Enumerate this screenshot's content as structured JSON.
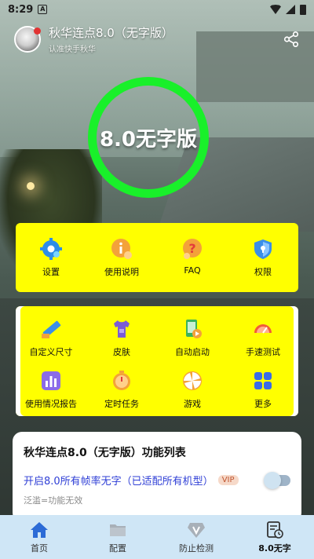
{
  "status_bar": {
    "time": "8:29",
    "a_badge": "A"
  },
  "header": {
    "title": "秋华连点8.0（无字版）",
    "subtitle": "认准快手秋华"
  },
  "ring": {
    "text": "8.0无字版",
    "color": "#19f02a"
  },
  "top_menu": [
    {
      "label": "设置",
      "icon": "gear-icon"
    },
    {
      "label": "使用说明",
      "icon": "info-icon"
    },
    {
      "label": "FAQ",
      "icon": "question-icon"
    },
    {
      "label": "权限",
      "icon": "shield-icon"
    }
  ],
  "tools_menu": [
    {
      "label": "自定义尺寸",
      "icon": "ruler-icon"
    },
    {
      "label": "皮肤",
      "icon": "tshirt-icon"
    },
    {
      "label": "自动启动",
      "icon": "auto-start-icon"
    },
    {
      "label": "手速测试",
      "icon": "speedometer-icon"
    },
    {
      "label": "使用情况报告",
      "icon": "bar-chart-icon"
    },
    {
      "label": "定时任务",
      "icon": "stopwatch-icon"
    },
    {
      "label": "游戏",
      "icon": "pinwheel-icon"
    },
    {
      "label": "更多",
      "icon": "grid-icon"
    }
  ],
  "feature_card": {
    "title": "秋华连点8.0（无字版）功能列表",
    "feature_name": "开启8.0所有帧率无字（已适配所有机型）",
    "vip_badge": "VIP",
    "note": "泛滥=功能无效",
    "toggle_on": false
  },
  "bottom_nav": [
    {
      "label": "首页",
      "icon": "home-icon",
      "active": false
    },
    {
      "label": "配置",
      "icon": "folder-icon",
      "active": false
    },
    {
      "label": "防止检测",
      "icon": "diamond-v-icon",
      "active": false
    },
    {
      "label": "8.0无字",
      "icon": "document-clock-icon",
      "active": true
    }
  ],
  "colors": {
    "panel": "#ffff00",
    "accent_blue": "#2f3fd6",
    "nav_bg": "#cfe6f6",
    "home_blue": "#2c6bd6"
  }
}
